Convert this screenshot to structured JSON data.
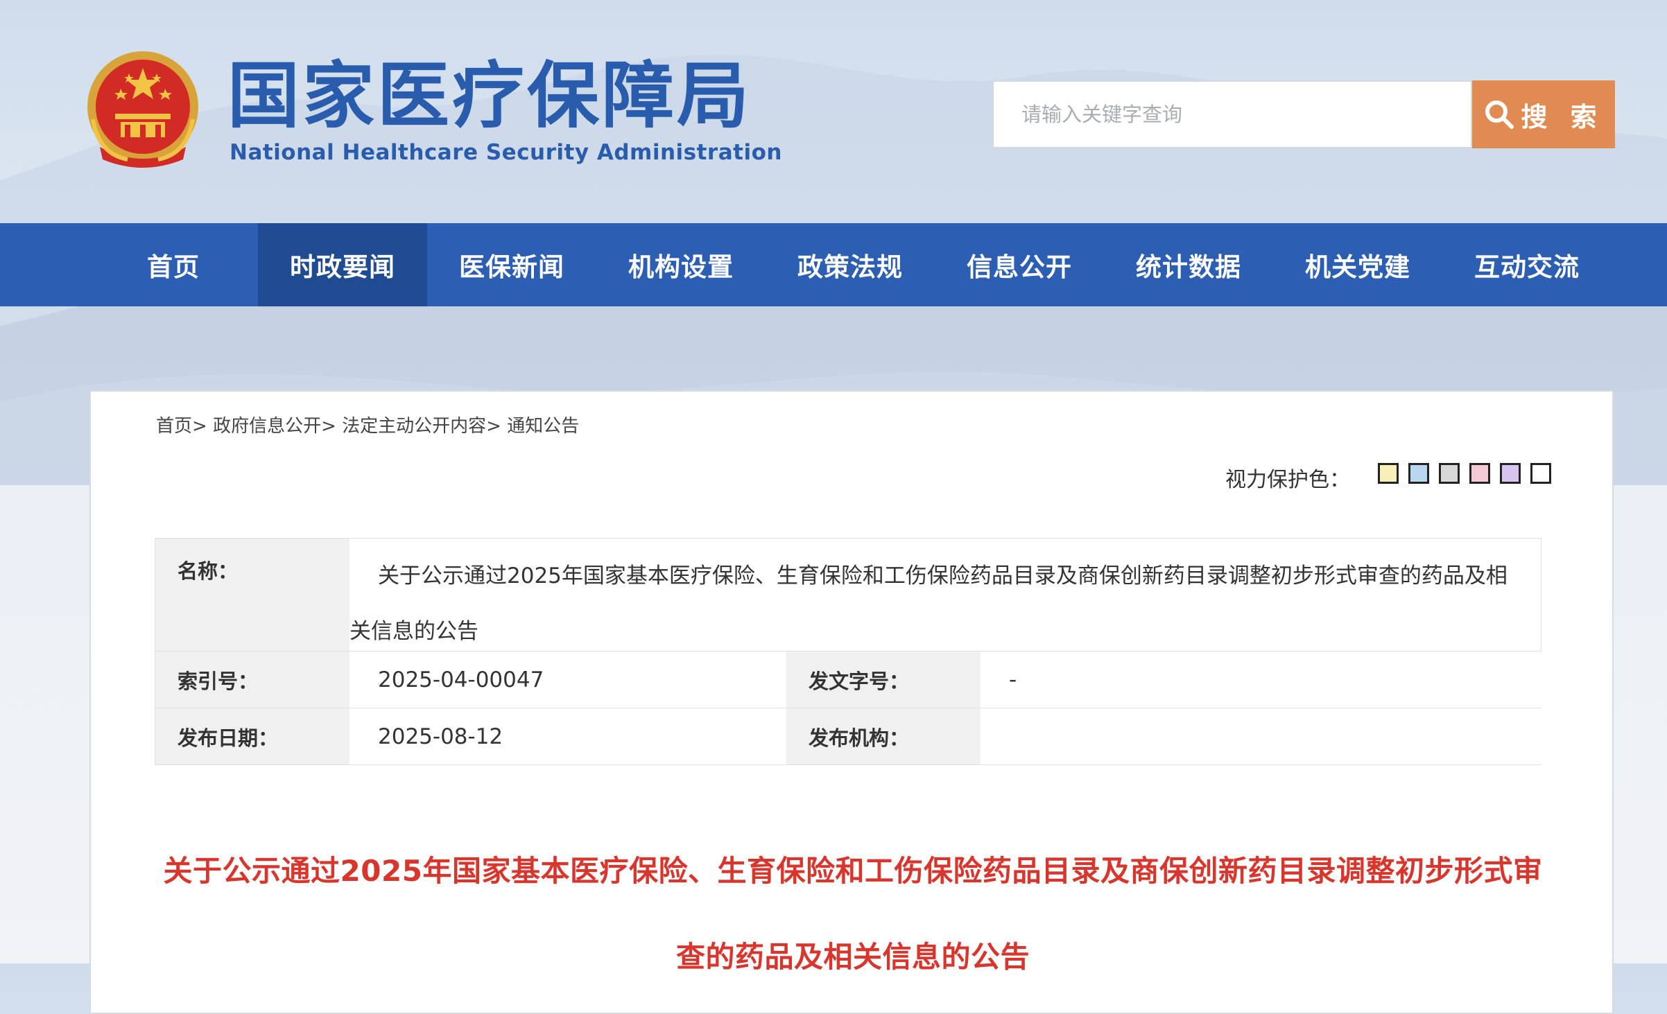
{
  "site": {
    "title": "国家医疗保障局",
    "subtitle": "National Healthcare Security Administration"
  },
  "search": {
    "placeholder": "请输入关键字查询",
    "button_label": "搜 索"
  },
  "nav": {
    "items": [
      {
        "label": "首页"
      },
      {
        "label": "时政要闻",
        "active": true
      },
      {
        "label": "医保新闻"
      },
      {
        "label": "机构设置"
      },
      {
        "label": "政策法规"
      },
      {
        "label": "信息公开"
      },
      {
        "label": "统计数据"
      },
      {
        "label": "机关党建"
      },
      {
        "label": "互动交流"
      }
    ]
  },
  "breadcrumb": {
    "items": [
      "首页",
      "政府信息公开",
      "法定主动公开内容",
      "通知公告"
    ],
    "separator": ">"
  },
  "eye_care": {
    "label": "视力保护色：",
    "swatches": [
      "#f8f0b8",
      "#b8d8f0",
      "#d8d8d8",
      "#f4c8d4",
      "#d8c4f0",
      "#ffffff"
    ]
  },
  "meta": {
    "name_label": "名称：",
    "name_value": "关于公示通过2025年国家基本医疗保险、生育保险和工伤保险药品目录及商保创新药目录调整初步形式审查的药品及相关信息的公告",
    "index_label": "索引号：",
    "index_value": "2025-04-00047",
    "doc_no_label": "发文字号：",
    "doc_no_value": "-",
    "date_label": "发布日期：",
    "date_value": "2025-08-12",
    "org_label": "发布机构：",
    "org_value": ""
  },
  "article": {
    "title": "关于公示通过2025年国家基本医疗保险、生育保险和工伤保险药品目录及商保创新药目录调整初步形式审查的药品及相关信息的公告"
  },
  "colors": {
    "brand_blue": "#2a5cad",
    "nav_bg": "#2c5fb3",
    "nav_active": "#1f4b92",
    "search_button": "#e18a52",
    "title_red": "#d8352c"
  }
}
